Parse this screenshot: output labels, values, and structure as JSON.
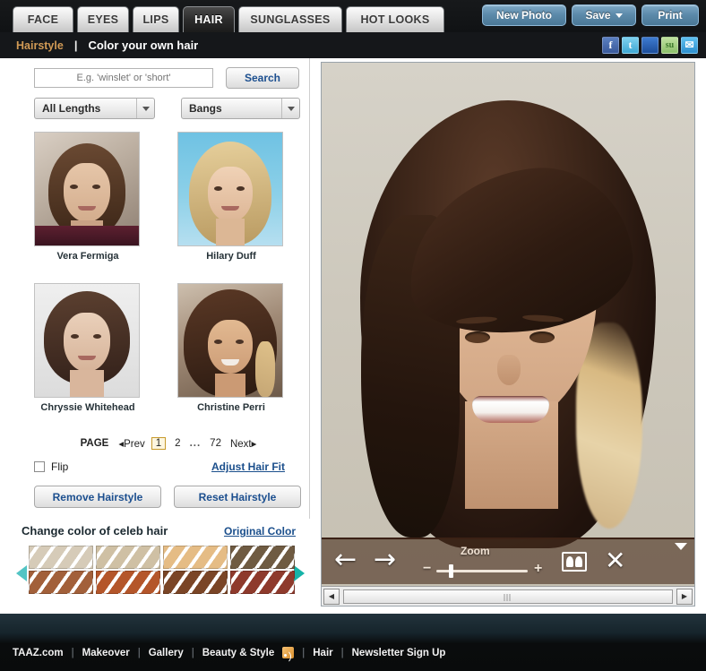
{
  "app": {
    "tabs": [
      {
        "label": "FACE",
        "active": false
      },
      {
        "label": "EYES",
        "active": false
      },
      {
        "label": "LIPS",
        "active": false
      },
      {
        "label": "HAIR",
        "active": true
      },
      {
        "label": "SUNGLASSES",
        "active": false
      },
      {
        "label": "HOT LOOKS",
        "active": false
      }
    ],
    "actions": {
      "new_photo": "New Photo",
      "save": "Save",
      "print": "Print"
    },
    "breadcrumb": {
      "section": "Hairstyle",
      "separator": "|",
      "title": "Color your own hair"
    },
    "social": [
      {
        "name": "facebook-icon",
        "glyph": "f"
      },
      {
        "name": "twitter-icon",
        "glyph": "t"
      },
      {
        "name": "myspace-icon",
        "glyph": " "
      },
      {
        "name": "stumbleupon-icon",
        "glyph": "su"
      },
      {
        "name": "email-icon",
        "glyph": "✉"
      }
    ]
  },
  "sidebar": {
    "search": {
      "placeholder": "E.g. 'winslet' or 'short'",
      "value": "",
      "button_label": "Search"
    },
    "filters": [
      {
        "name": "length",
        "value": "All Lengths"
      },
      {
        "name": "bangs",
        "value": "Bangs"
      }
    ],
    "hairstyles": [
      {
        "name": "Vera Fermiga"
      },
      {
        "name": "Hilary Duff"
      },
      {
        "name": "Chryssie Whitehead"
      },
      {
        "name": "Christine Perri"
      }
    ],
    "pagination": {
      "label": "PAGE",
      "prev": "◂Prev",
      "pages": [
        "1",
        "2"
      ],
      "current": "1",
      "dots": "...",
      "last": "72",
      "next": "Next▸"
    },
    "flip": {
      "label": "Flip",
      "checked": false
    },
    "adjust_link": "Adjust Hair Fit",
    "buttons": {
      "remove": "Remove Hairstyle",
      "reset": "Reset Hairstyle"
    },
    "color": {
      "title": "Change color of celeb hair",
      "original_link": "Original Color",
      "swatches": [
        "#d6cbb8",
        "#cfc0a4",
        "#e5bc85",
        "#6f5b42",
        "#a2603a",
        "#b4562a",
        "#7a4526",
        "#8e3a2c"
      ]
    }
  },
  "viewer": {
    "toolbar": {
      "back": "←",
      "forward": "→",
      "zoom_label": "Zoom",
      "zoom_minus": "−",
      "zoom_plus": "+",
      "zoom_value": "15",
      "compare": "compare-icon",
      "close": "✕",
      "collapse": "collapse-icon"
    },
    "scroll": {
      "left": "◀",
      "right": "▶"
    }
  },
  "footer": {
    "links": [
      "TAAZ.com",
      "Makeover",
      "Gallery",
      "Beauty & Style",
      "Hair",
      "Newsletter Sign Up"
    ],
    "separator": "|",
    "rss": "rss-icon"
  }
}
